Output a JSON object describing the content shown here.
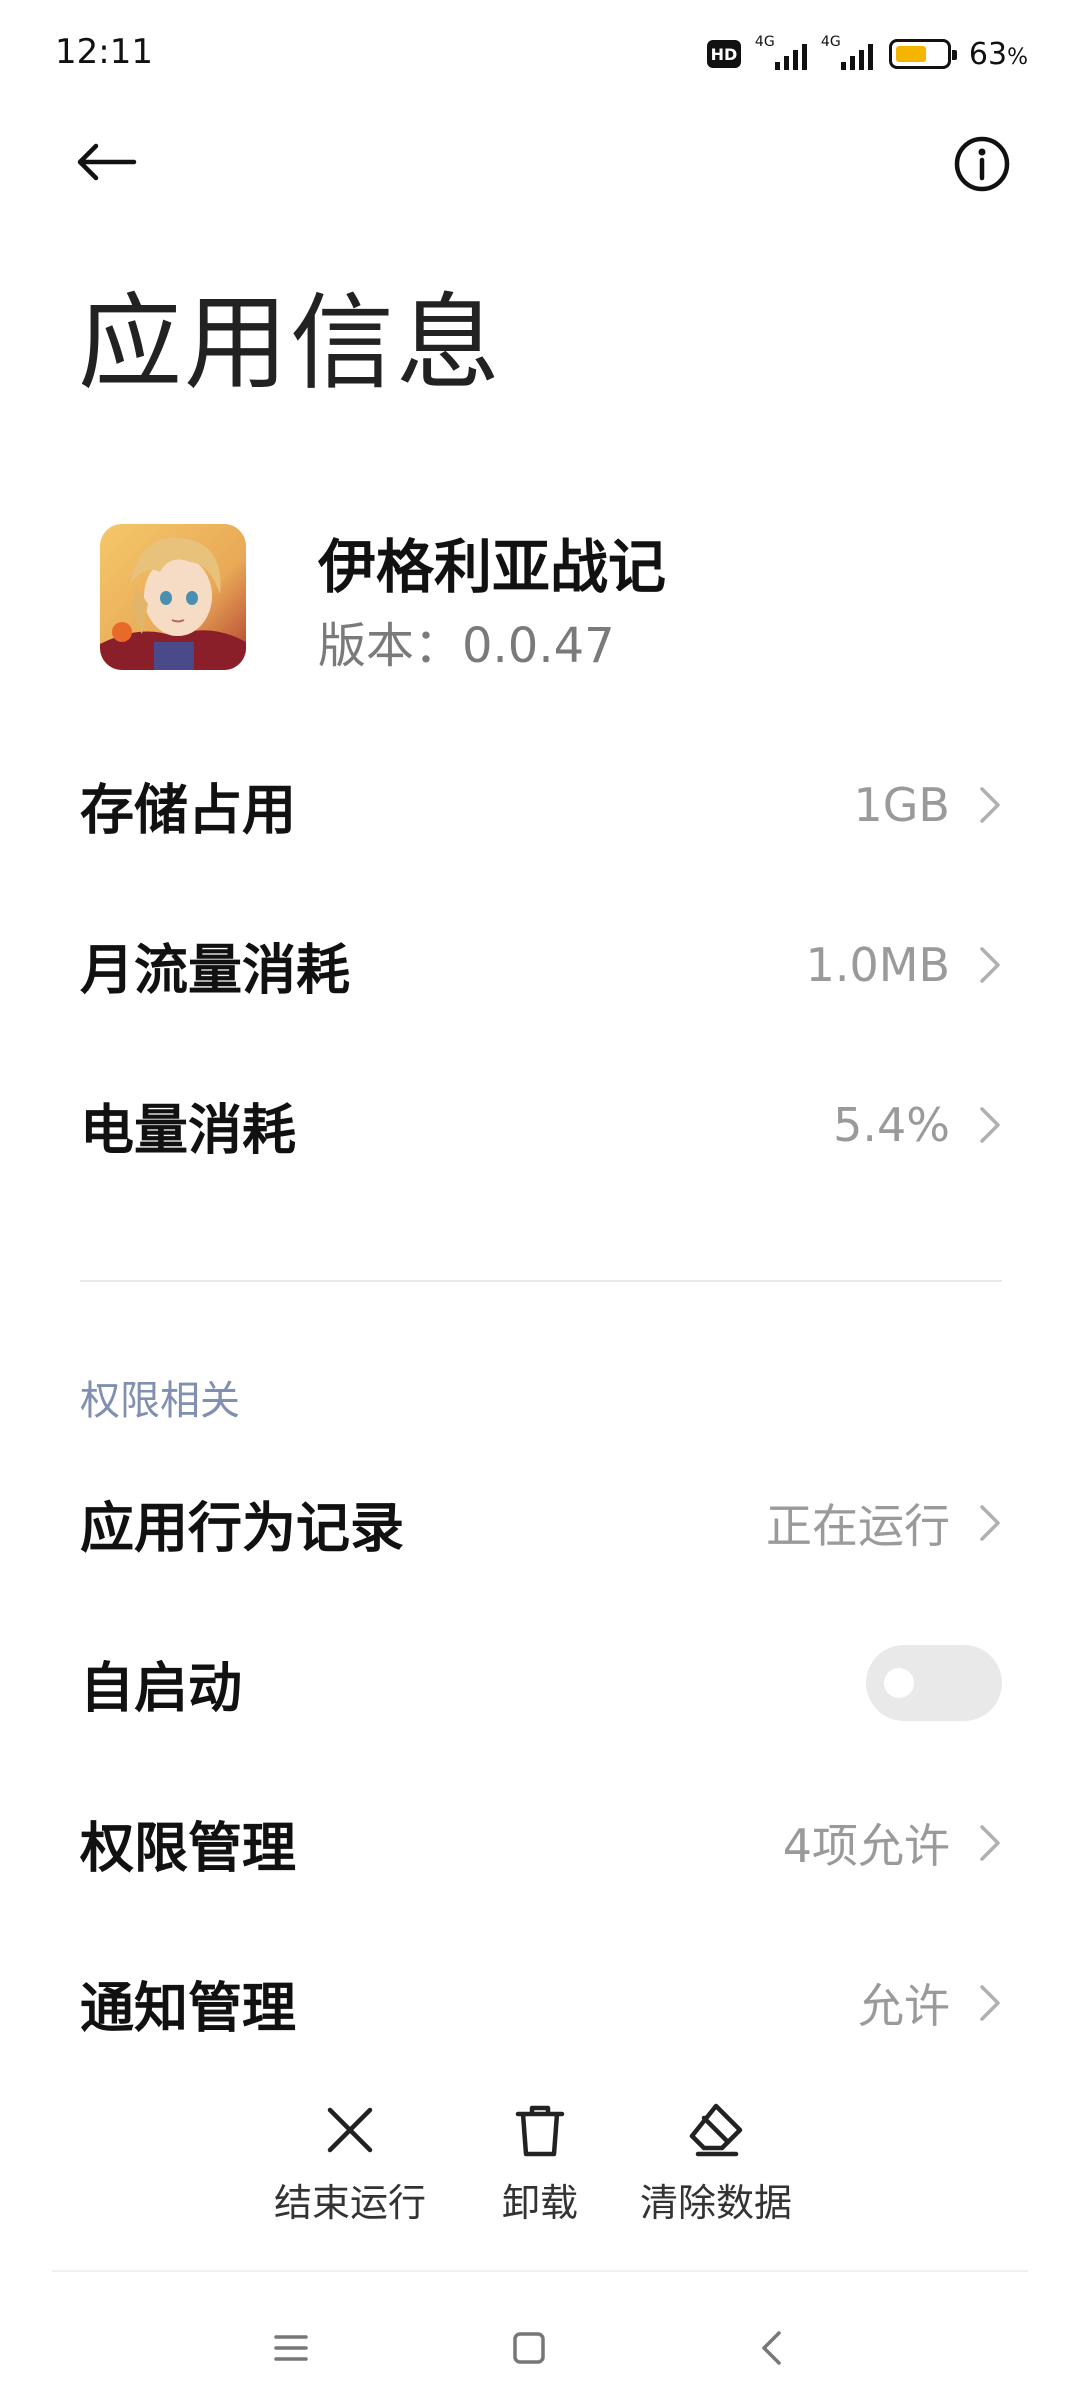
{
  "status_bar": {
    "time": "12:11",
    "network_badge": "HD",
    "sim1_type": "4G",
    "sim2_type": "4G",
    "battery_percent": "63",
    "battery_unit": "%",
    "battery_level": 0.63,
    "battery_color": "#f5b400"
  },
  "header": {
    "back_icon": "arrow-left-icon",
    "info_icon": "info-circle-icon",
    "title": "应用信息"
  },
  "app": {
    "name": "伊格利亚战记",
    "version": "版本：0.0.47"
  },
  "rows": {
    "storage": {
      "label": "存储占用",
      "value": "1GB"
    },
    "data_usage": {
      "label": "月流量消耗",
      "value": "1.0MB"
    },
    "battery_usage": {
      "label": "电量消耗",
      "value": "5.4%"
    }
  },
  "permissions_section": {
    "title": "权限相关",
    "behavior_log": {
      "label": "应用行为记录",
      "value": "正在运行"
    },
    "autostart": {
      "label": "自启动",
      "enabled": false
    },
    "permission_mgmt": {
      "label": "权限管理",
      "value": "4项允许"
    },
    "notification_mgmt": {
      "label": "通知管理",
      "value": "允许"
    }
  },
  "actions": {
    "force_stop": "结束运行",
    "uninstall": "卸载",
    "clear_data": "清除数据"
  },
  "nav_bar": {
    "menu_icon": "menu-icon",
    "home_icon": "home-square-icon",
    "back_icon": "back-chevron-icon"
  },
  "colors": {
    "section_title": "#8190b0",
    "value_text": "#9a9a9a",
    "toggle_off": "#e9e9e9"
  }
}
